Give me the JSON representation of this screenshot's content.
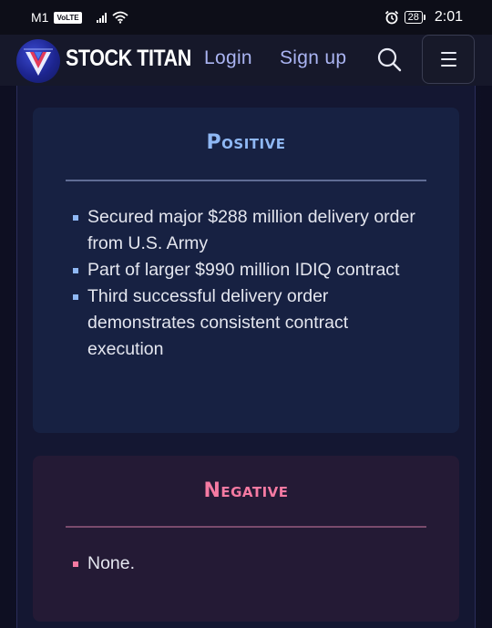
{
  "status_bar": {
    "carrier": "M1",
    "volte": "VoLTE",
    "battery": "28",
    "time": "2:01"
  },
  "header": {
    "brand": "STOCK TITAN",
    "login_label": "Login",
    "signup_label": "Sign up",
    "search_icon": "search-icon",
    "menu_icon": "hamburger-menu-icon"
  },
  "positive": {
    "title": "Positive",
    "accent_color": "#8fb8f4",
    "items": [
      "Secured major $288 million delivery order from U.S. Army",
      "Part of larger $990 million IDIQ contract",
      "Third successful delivery order demonstrates consistent contract execution"
    ]
  },
  "negative": {
    "title": "Negative",
    "accent_color": "#f57aa2",
    "items": [
      "None."
    ]
  }
}
